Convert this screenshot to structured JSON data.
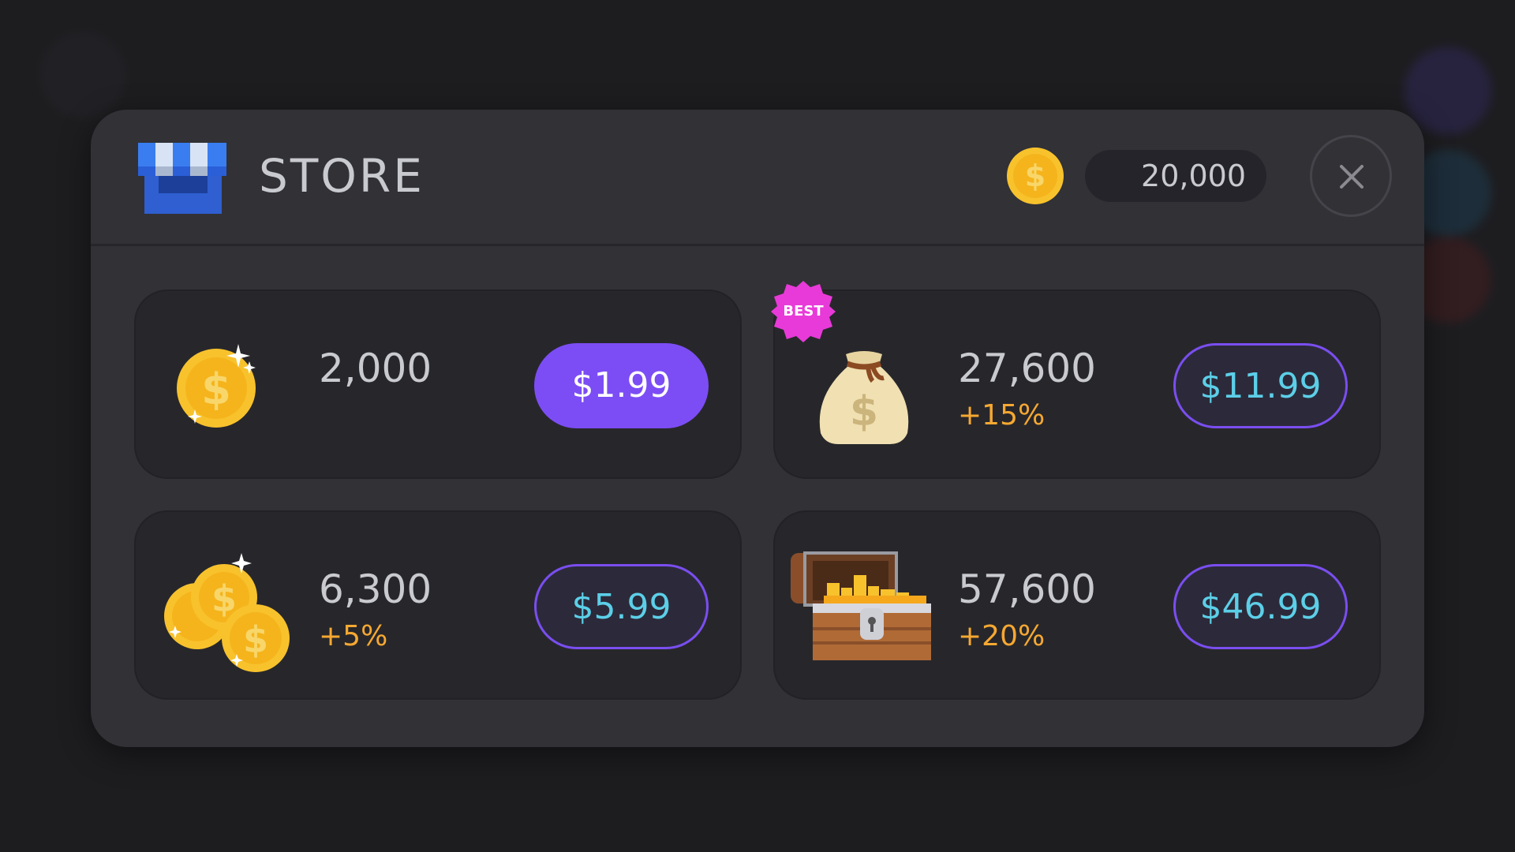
{
  "store": {
    "title": "STORE",
    "balance": "20,000"
  },
  "packs": [
    {
      "amount": "2,000",
      "bonus": "",
      "price": "$1.99",
      "icon": "coin-stack-small-icon",
      "style": "primary"
    },
    {
      "amount": "27,600",
      "bonus": "+15%",
      "price": "$11.99",
      "icon": "money-bag-icon",
      "badge": "BEST",
      "style": "outline"
    },
    {
      "amount": "6,300",
      "bonus": "+5%",
      "price": "$5.99",
      "icon": "coin-pile-icon",
      "style": "outline"
    },
    {
      "amount": "57,600",
      "bonus": "+20%",
      "price": "$46.99",
      "icon": "treasure-chest-icon",
      "style": "outline"
    }
  ],
  "colors": {
    "accent": "#7c4df5",
    "price_text": "#5ccfe8",
    "bonus": "#f6a832",
    "badge": "#e83ad8",
    "coin": "#f8c22d"
  }
}
